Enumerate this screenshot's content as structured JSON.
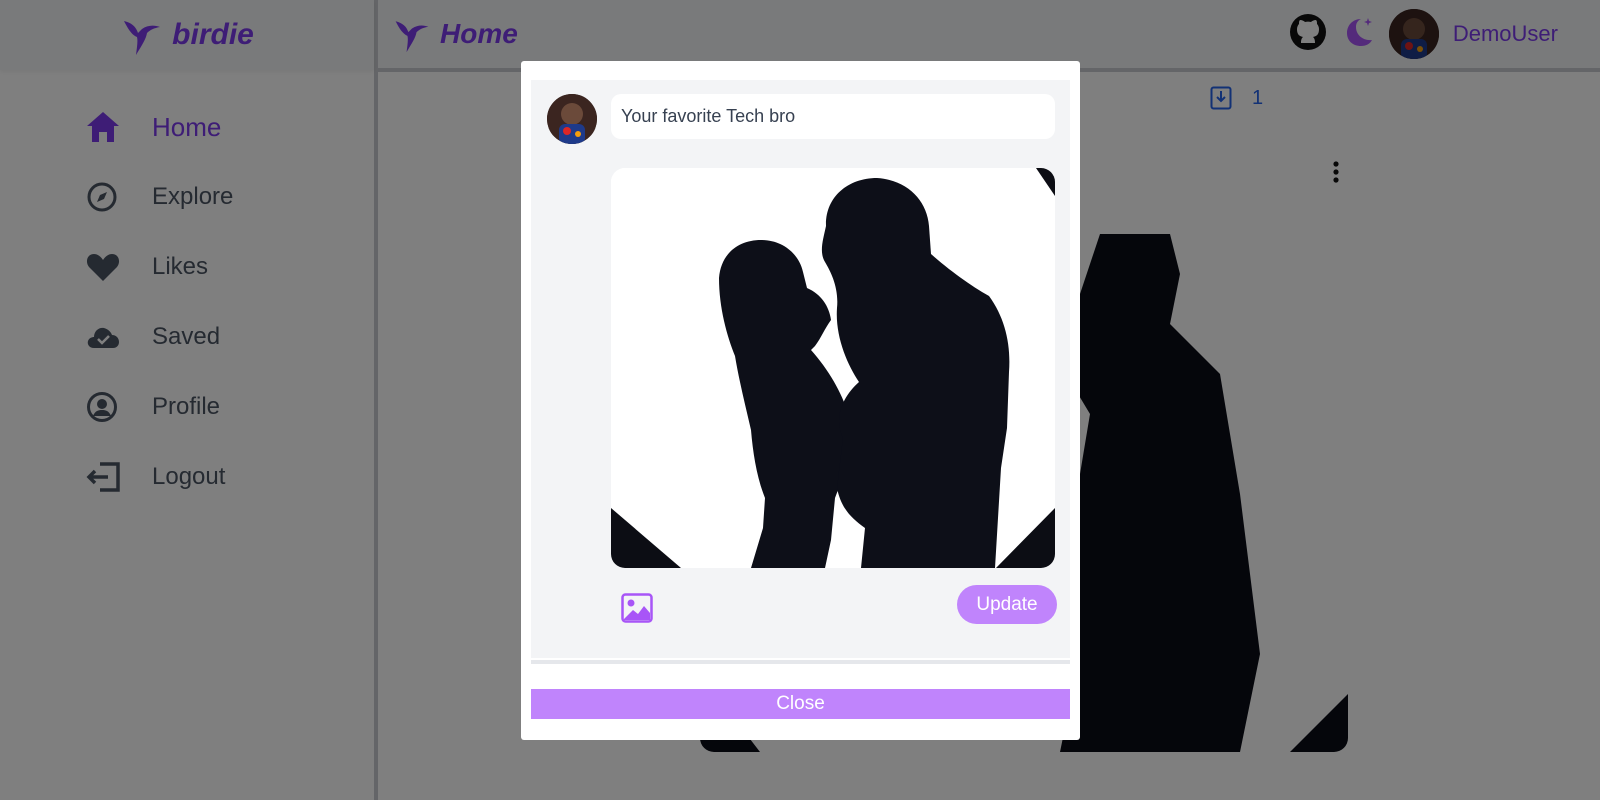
{
  "app": {
    "brand": "birdie"
  },
  "sidebar": {
    "items": [
      {
        "label": "Home",
        "icon": "home-icon",
        "active": true
      },
      {
        "label": "Explore",
        "icon": "compass-icon"
      },
      {
        "label": "Likes",
        "icon": "heart-icon"
      },
      {
        "label": "Saved",
        "icon": "cloud-check-icon"
      },
      {
        "label": "Profile",
        "icon": "user-circle-icon"
      },
      {
        "label": "Logout",
        "icon": "logout-icon"
      }
    ]
  },
  "header": {
    "title": "Home",
    "username": "DemoUser",
    "github_icon": "github-icon",
    "theme_icon": "moon-icon"
  },
  "feed": {
    "saved_count": "1"
  },
  "modal": {
    "post_text": "Your favorite Tech bro",
    "update_label": "Update",
    "close_label": "Close",
    "image_icon": "image-icon"
  },
  "colors": {
    "accent": "#7c3aed",
    "button": "#c084fc",
    "link": "#2563eb"
  }
}
